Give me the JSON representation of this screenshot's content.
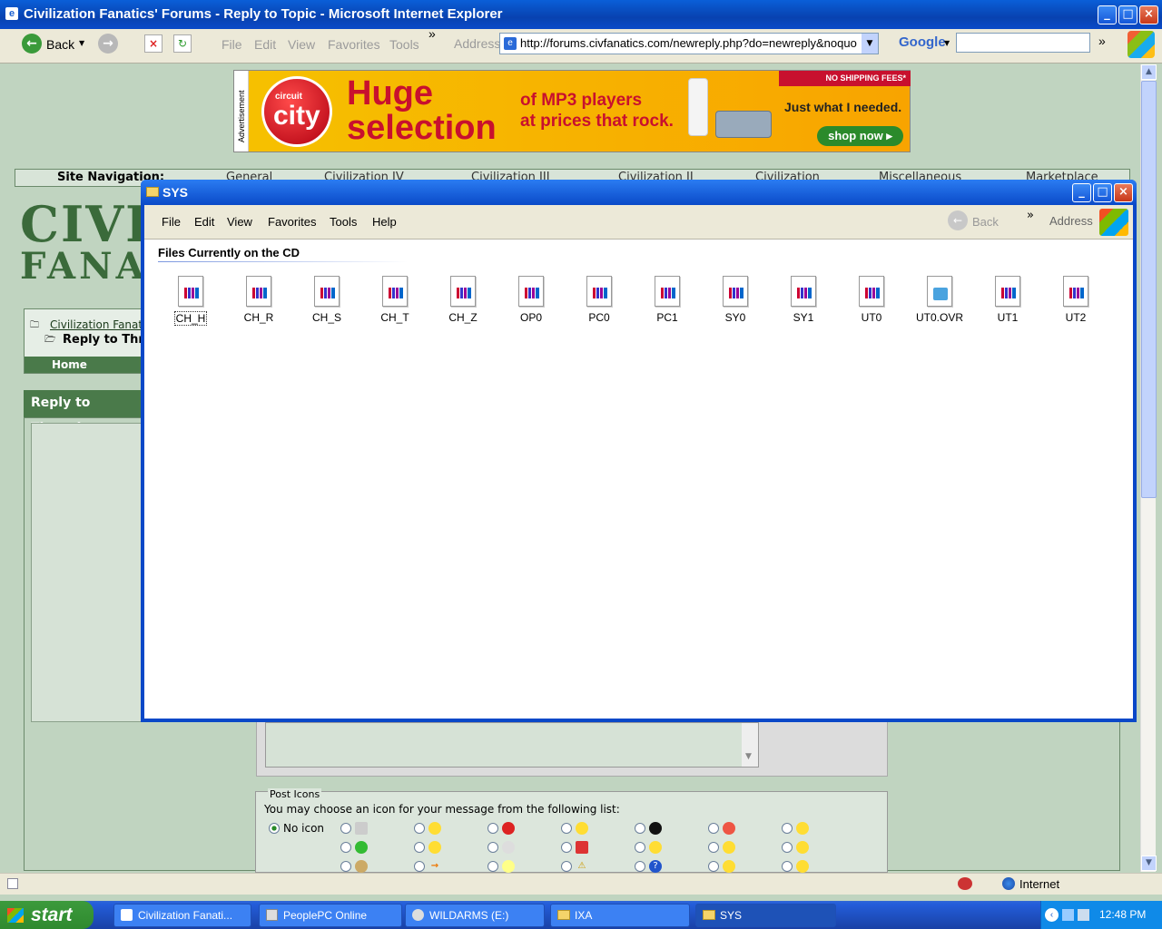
{
  "ie": {
    "title": "Civilization Fanatics' Forums - Reply to Topic - Microsoft Internet Explorer",
    "back_label": "Back",
    "menu": [
      "File",
      "Edit",
      "View",
      "Favorites",
      "Tools"
    ],
    "address_label": "Address",
    "address_url": "http://forums.civfanatics.com/newreply.php?do=newreply&noquo",
    "google_label": "Google",
    "overflow": "»"
  },
  "ad": {
    "side_label": "Advertisement",
    "brand_top": "circuit",
    "brand": "city",
    "headline_1": "Huge",
    "headline_2": "selection",
    "sub_1": "of MP3 players",
    "sub_2": "at prices that rock.",
    "badge": "NO SHIPPING FEES*",
    "tagline": "Just what I needed.",
    "cta": "shop now"
  },
  "site": {
    "nav_label": "Site Navigation:",
    "nav_items": [
      "General",
      "Civilization IV",
      "Civilization III",
      "Civilization II",
      "Civilization",
      "Miscellaneous",
      "Marketplace"
    ],
    "logo_1": "CIVIL",
    "logo_2": "FANAT",
    "breadcrumb_root": "Civilization Fanati",
    "breadcrumb_current": "Reply to Thr",
    "home": "Home",
    "reply_header": "Reply to Thread",
    "post_icons_title": "Post Icons",
    "post_icons_desc": "You may choose an icon for your message from the following list:",
    "no_icon": "No icon"
  },
  "sys": {
    "title": "SYS",
    "menu": [
      "File",
      "Edit",
      "View",
      "Favorites",
      "Tools",
      "Help"
    ],
    "back": "Back",
    "address": "Address",
    "header": "Files Currently on the CD",
    "files": [
      "CH_H",
      "CH_R",
      "CH_S",
      "CH_T",
      "CH_Z",
      "OP0",
      "PC0",
      "PC1",
      "SY0",
      "SY1",
      "UT0",
      "UT0.OVR",
      "UT1",
      "UT2"
    ]
  },
  "status": {
    "zone": "Internet"
  },
  "taskbar": {
    "start": "start",
    "tasks": [
      "Civilization Fanati...",
      "PeoplePC Online",
      "WILDARMS (E:)",
      "IXA",
      "SYS"
    ],
    "clock": "12:48 PM"
  },
  "colors": {
    "xp_blue": "#0a4ac8",
    "page_green": "#c0d4c0",
    "ad_red": "#c8102e"
  }
}
